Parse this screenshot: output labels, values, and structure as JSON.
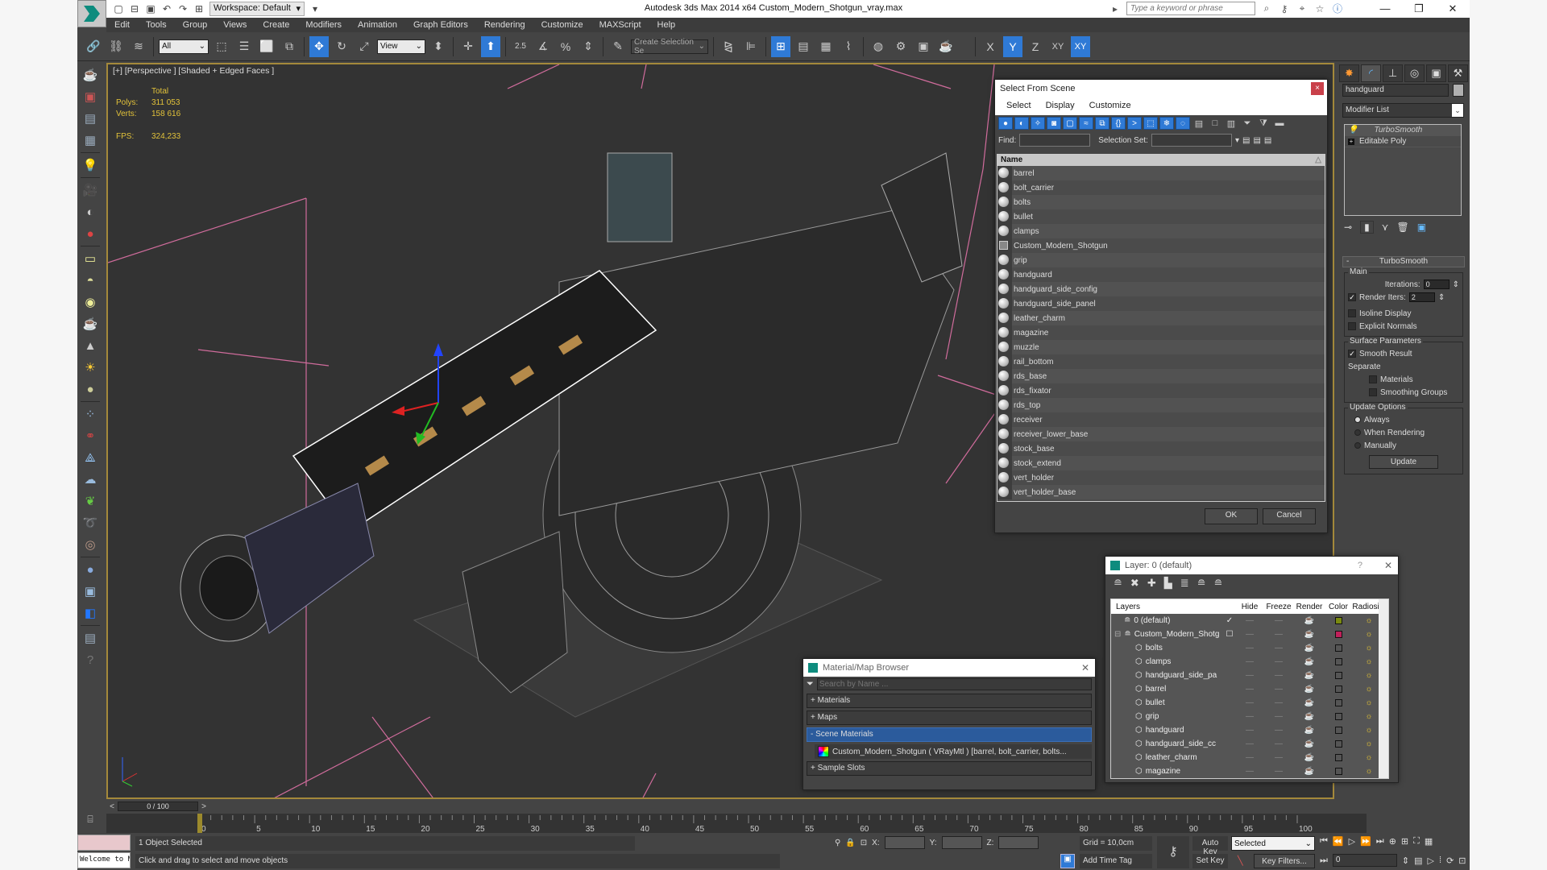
{
  "titlebar": {
    "app_title": "Autodesk 3ds Max  2014 x64     Custom_Modern_Shotgun_vray.max",
    "workspace_label": "Workspace: Default",
    "help_search_placeholder": "Type a keyword or phrase"
  },
  "menu": [
    "Edit",
    "Tools",
    "Group",
    "Views",
    "Create",
    "Modifiers",
    "Animation",
    "Graph Editors",
    "Rendering",
    "Customize",
    "MAXScript",
    "Help"
  ],
  "toolbar": {
    "selection_filter": "All",
    "ref_coord": "View",
    "snap_value": "2.5",
    "named_selection_placeholder": "Create Selection Se",
    "axis_buttons": [
      "X",
      "Y",
      "Z",
      "XY",
      "XY"
    ]
  },
  "viewport": {
    "label": "[+] [Perspective ] [Shaded + Edged Faces ]",
    "stats": {
      "header": "Total",
      "polys_label": "Polys:",
      "polys": "311 053",
      "verts_label": "Verts:",
      "verts": "158 616",
      "fps_label": "FPS:",
      "fps": "324,233"
    }
  },
  "command_panel": {
    "object_name": "handguard",
    "modifier_list": "Modifier List",
    "stack": [
      "TurboSmooth",
      "Editable Poly"
    ],
    "rollout": {
      "title": "TurboSmooth",
      "main_group": "Main",
      "iterations_label": "Iterations:",
      "iterations": "0",
      "render_iters_label": "Render Iters:",
      "render_iters": "2",
      "render_iters_checked": true,
      "isoline_display": "Isoline Display",
      "explicit_normals": "Explicit Normals",
      "surface_group": "Surface Parameters",
      "smooth_result": "Smooth Result",
      "separate_label": "Separate",
      "materials": "Materials",
      "smoothing_groups": "Smoothing Groups",
      "update_group": "Update Options",
      "always": "Always",
      "when_rendering": "When Rendering",
      "manually": "Manually",
      "update_button": "Update"
    }
  },
  "select_from_scene": {
    "title": "Select From Scene",
    "menu": [
      "Select",
      "Display",
      "Customize"
    ],
    "find_label": "Find:",
    "selection_set_label": "Selection Set:",
    "column_name": "Name",
    "items": [
      "barrel",
      "bolt_carrier",
      "bolts",
      "bullet",
      "clamps",
      "Custom_Modern_Shotgun",
      "grip",
      "handguard",
      "handguard_side_config",
      "handguard_side_panel",
      "leather_charm",
      "magazine",
      "muzzle",
      "rail_bottom",
      "rds_base",
      "rds_fixator",
      "rds_top",
      "receiver",
      "receiver_lower_base",
      "stock_base",
      "stock_extend",
      "vert_holder",
      "vert_holder_base"
    ],
    "group_item": "Custom_Modern_Shotgun",
    "ok": "OK",
    "cancel": "Cancel"
  },
  "layer_dialog": {
    "title": "Layer: 0 (default)",
    "help": "?",
    "columns": [
      "Layers",
      "Hide",
      "Freeze",
      "Render",
      "Color",
      "Radiosity"
    ],
    "rows": [
      {
        "name": "0 (default)",
        "current": "✓",
        "color": "#7a8a10",
        "level": 0
      },
      {
        "name": "Custom_Modern_Shotg",
        "current": "☐",
        "color": "#c0205a",
        "level": 0,
        "expand": "⊟"
      },
      {
        "name": "bolts",
        "color": "#555555",
        "level": 1
      },
      {
        "name": "clamps",
        "color": "#555555",
        "level": 1
      },
      {
        "name": "handguard_side_pa",
        "color": "#555555",
        "level": 1
      },
      {
        "name": "barrel",
        "color": "#555555",
        "level": 1
      },
      {
        "name": "bullet",
        "color": "#555555",
        "level": 1
      },
      {
        "name": "grip",
        "color": "#555555",
        "level": 1
      },
      {
        "name": "handguard",
        "color": "#555555",
        "level": 1
      },
      {
        "name": "handguard_side_cc",
        "color": "#555555",
        "level": 1
      },
      {
        "name": "leather_charm",
        "color": "#555555",
        "level": 1
      },
      {
        "name": "magazine",
        "color": "#555555",
        "level": 1
      }
    ]
  },
  "material_browser": {
    "title": "Material/Map Browser",
    "search_placeholder": "Search by Name ...",
    "categories": [
      "+ Materials",
      "+ Maps",
      "- Scene Materials",
      "+ Sample Slots"
    ],
    "scene_material": "Custom_Modern_Shotgun ( VRayMtl ) [barrel, bolt_carrier, bolts..."
  },
  "timeline": {
    "frame_display": "0 / 100",
    "prev": "<",
    "next": ">",
    "ticks": [
      0,
      5,
      10,
      15,
      20,
      25,
      30,
      35,
      40,
      45,
      50,
      55,
      60,
      65,
      70,
      75,
      80,
      85,
      90,
      95,
      100
    ]
  },
  "status": {
    "maxscript_output": "Welcome to M",
    "selection": "1 Object Selected",
    "prompt": "Click and drag to select and move objects",
    "x_label": "X:",
    "y_label": "Y:",
    "z_label": "Z:",
    "grid": "Grid = 10,0cm",
    "add_time_tag": "Add Time Tag",
    "auto_key": "Auto Key",
    "set_key": "Set Key",
    "key_mode": "Selected",
    "key_filters": "Key Filters...",
    "current_frame": "0"
  },
  "colors": {
    "accent": "#2f7ad6",
    "viewport_border": "#a4893b",
    "stats_text": "#e2c23a",
    "helper_lines": "#d06c9c"
  }
}
